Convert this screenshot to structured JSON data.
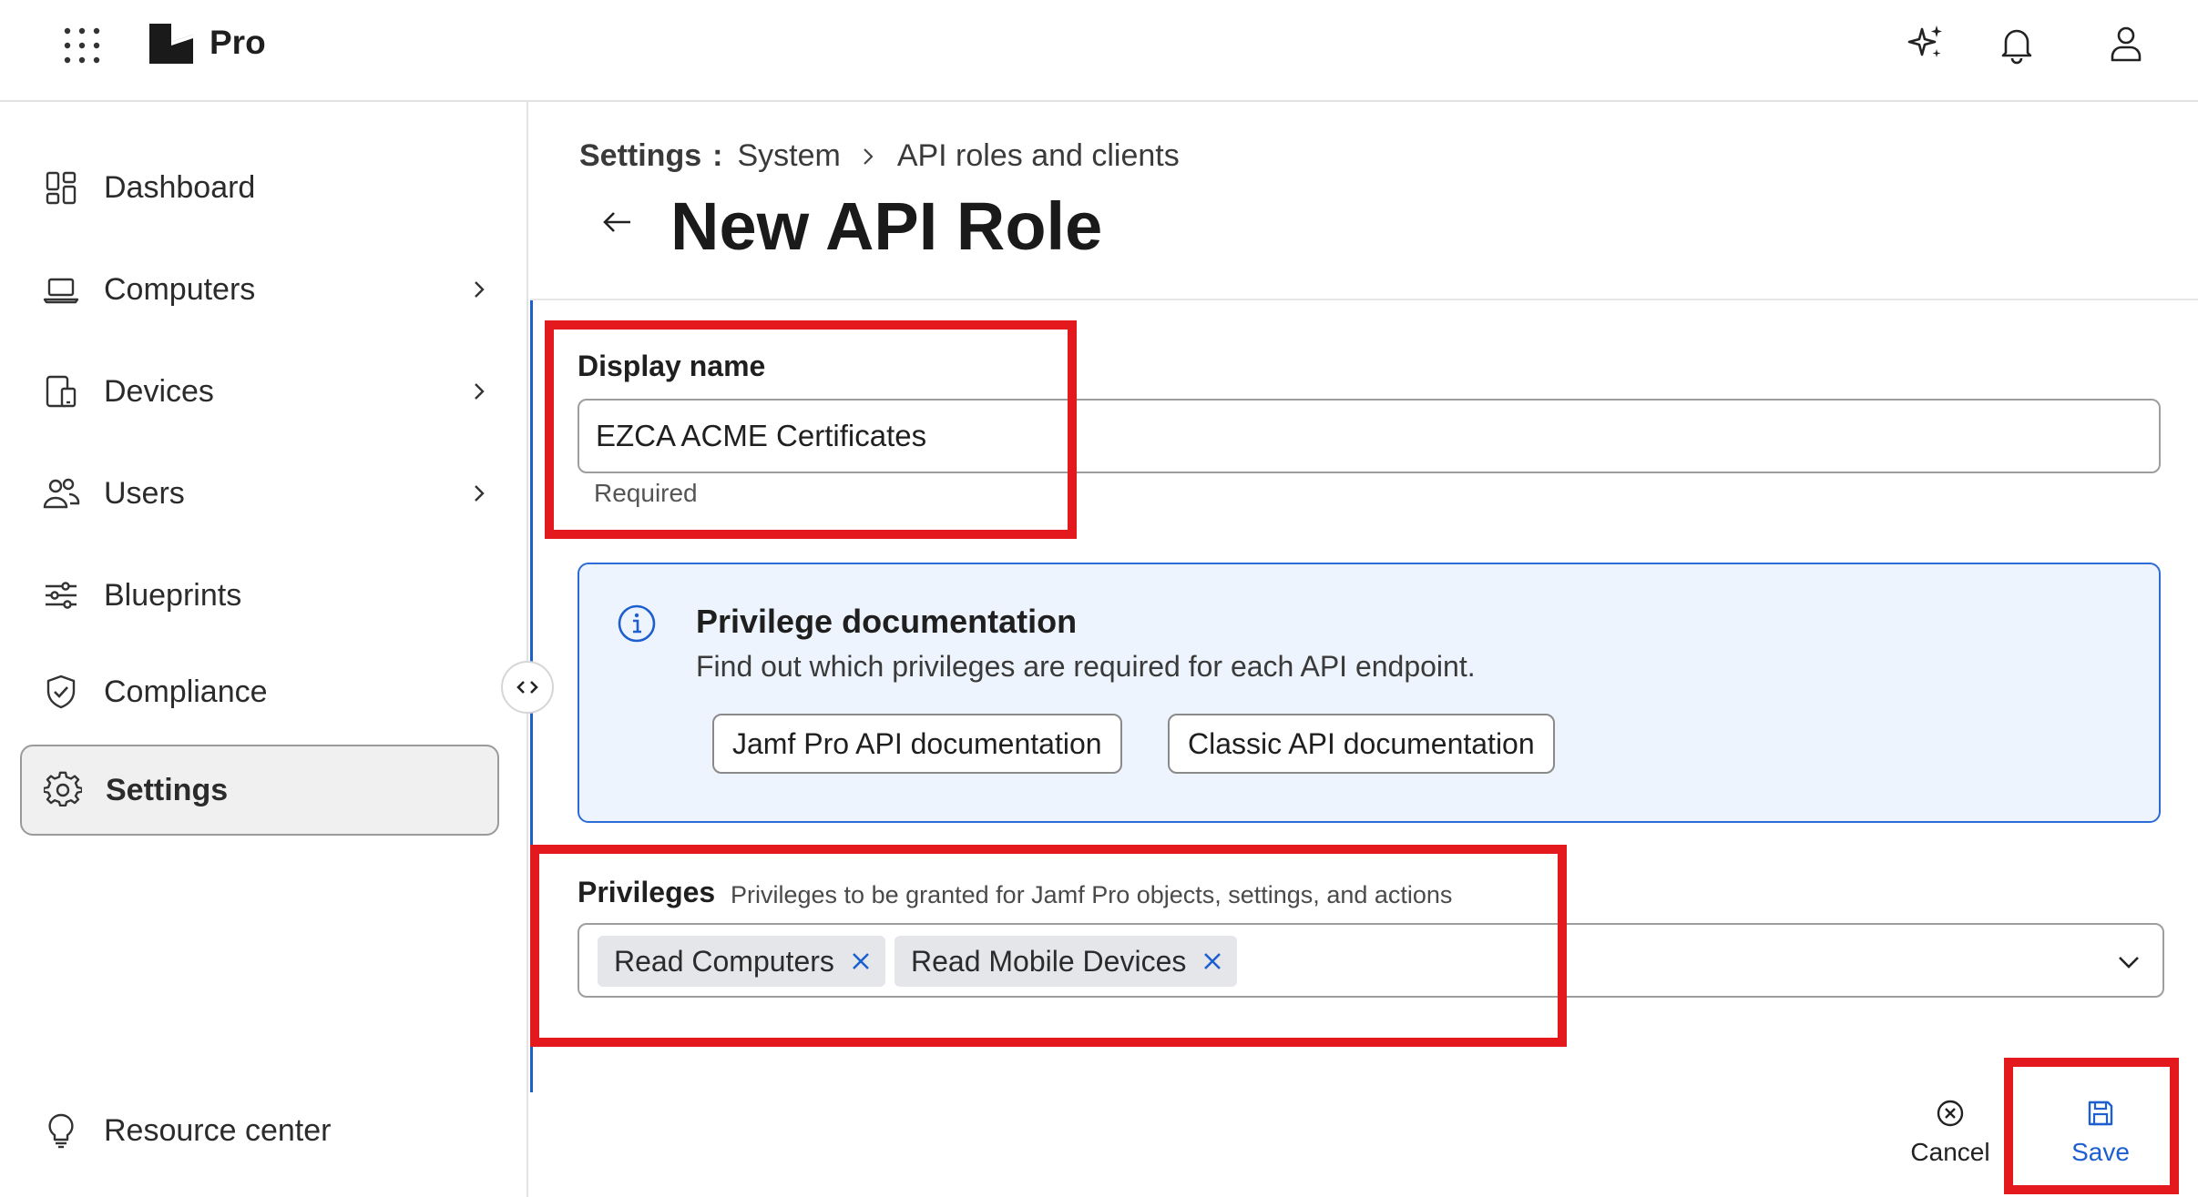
{
  "topbar": {
    "product_name": "Pro",
    "icons": [
      "app-grid-icon",
      "jamf-logo",
      "ai-sparkle-icon",
      "bell-icon",
      "user-icon"
    ]
  },
  "sidebar": {
    "items": [
      {
        "label": "Dashboard",
        "icon": "dashboard-icon",
        "has_chevron": false
      },
      {
        "label": "Computers",
        "icon": "laptop-icon",
        "has_chevron": true
      },
      {
        "label": "Devices",
        "icon": "devices-icon",
        "has_chevron": true
      },
      {
        "label": "Users",
        "icon": "users-icon",
        "has_chevron": true
      },
      {
        "label": "Blueprints",
        "icon": "sliders-icon",
        "has_chevron": false
      },
      {
        "label": "Compliance",
        "icon": "shield-check-icon",
        "has_chevron": false
      },
      {
        "label": "Settings",
        "icon": "gear-icon",
        "has_chevron": false,
        "active": true
      }
    ],
    "footer_item": {
      "label": "Resource center",
      "icon": "lightbulb-icon"
    },
    "collapse_label": "‹›"
  },
  "breadcrumb": {
    "root": "Settings",
    "separator": ":",
    "items": [
      "System",
      "API roles and clients"
    ]
  },
  "page": {
    "title": "New API Role"
  },
  "form": {
    "display_name": {
      "label": "Display name",
      "value": "EZCA ACME Certificates",
      "helper": "Required"
    },
    "privilege_docs": {
      "title": "Privilege documentation",
      "text": "Find out which privileges are required for each API endpoint.",
      "buttons": [
        "Jamf Pro API documentation",
        "Classic API documentation"
      ]
    },
    "privileges": {
      "label": "Privileges",
      "description": "Privileges to be granted for Jamf Pro objects, settings, and actions",
      "selected": [
        "Read Computers",
        "Read Mobile Devices"
      ]
    }
  },
  "footer": {
    "cancel_label": "Cancel",
    "save_label": "Save"
  },
  "colors": {
    "accent": "#1e5fd0",
    "annotation": "#e3191d",
    "info_bg": "#eef4fd"
  }
}
